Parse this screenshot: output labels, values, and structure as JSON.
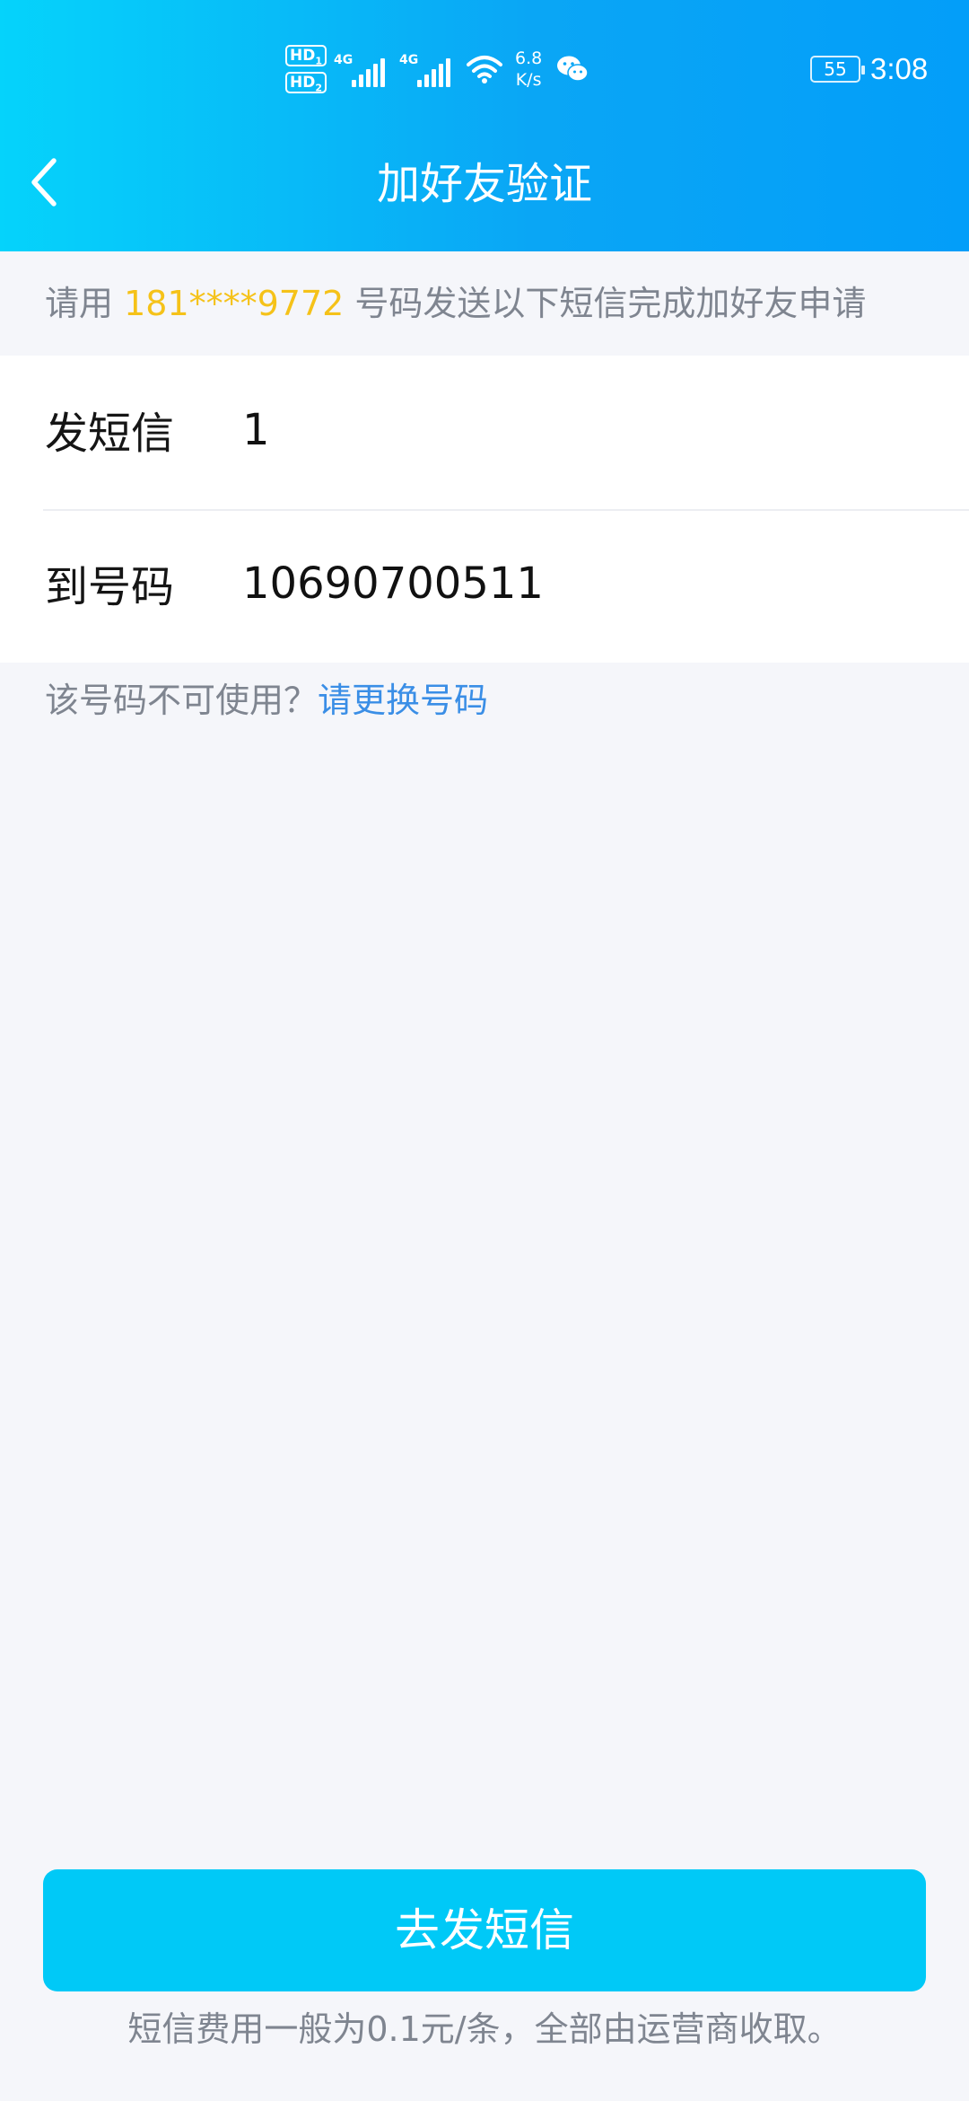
{
  "status_bar": {
    "sim1": "HD",
    "sim1_index": "1",
    "sim2": "HD",
    "sim2_index": "2",
    "net1": "4G",
    "net2": "4G",
    "speed_value": "6.8",
    "speed_unit": "K/s",
    "battery": "55",
    "time": "3:08"
  },
  "header": {
    "title": "加好友验证"
  },
  "notice": {
    "prefix": "请用 ",
    "phone": "181****9772",
    "suffix": " 号码发送以下短信完成加好友申请"
  },
  "form": {
    "rows": [
      {
        "label": "发短信",
        "value": "1"
      },
      {
        "label": "到号码",
        "value": "10690700511"
      }
    ]
  },
  "change_number": {
    "prompt": "该号码不可使用？",
    "link": "请更换号码"
  },
  "footer": {
    "button_label": "去发短信",
    "fee_note": "短信费用一般为0.1元/条，全部由运营商收取。"
  },
  "colors": {
    "header_gradient_start": "#05d3fb",
    "header_gradient_end": "#039ef9",
    "phone_highlight": "#f5c219",
    "link": "#3a8ee6",
    "button": "#00c9f7"
  }
}
